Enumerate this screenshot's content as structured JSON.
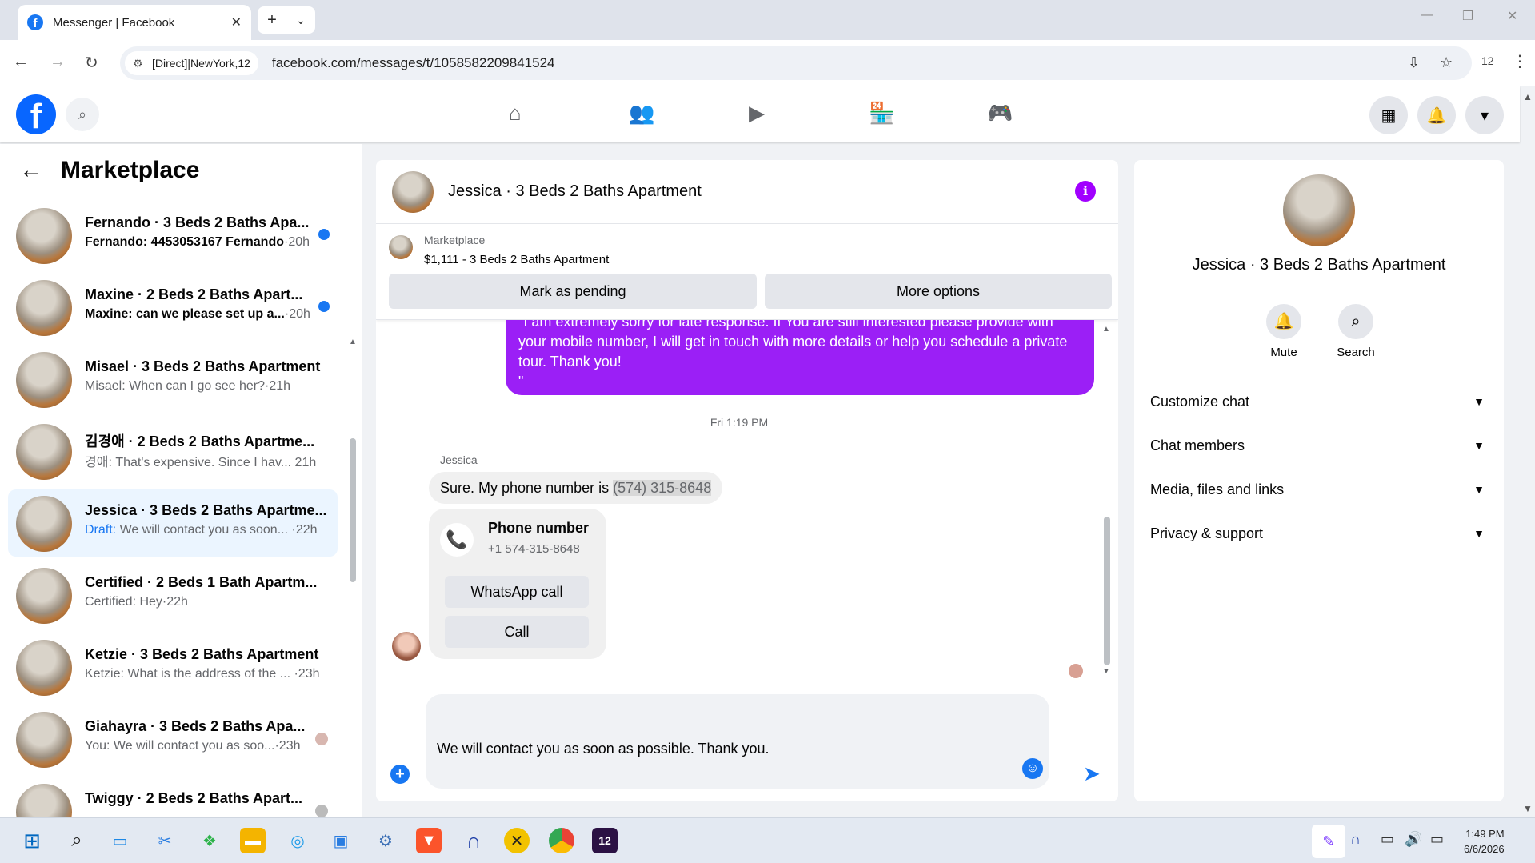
{
  "browser": {
    "tab_title": "Messenger | Facebook",
    "url": "facebook.com/messages/t/1058582209841524",
    "site_chip": "[Direct]|NewYork,12",
    "profile_count": "12"
  },
  "left": {
    "title": "Marketplace",
    "conversations": [
      {
        "name": "Fernando · 3 Beds 2 Baths Apa...",
        "preview": "Fernando: 4453053167 Fernando",
        "time": "·20h",
        "unread": true
      },
      {
        "name": "Maxine · 2 Beds 2 Baths Apart...",
        "preview": "Maxine: can we please set up a...",
        "time": "·20h",
        "unread": true
      },
      {
        "name": "Misael · 3 Beds 2 Baths Apartment",
        "preview": "Misael: When can I go see her?",
        "time": "·21h"
      },
      {
        "name": "김경애 · 2 Beds 2 Baths Apartme...",
        "preview": "경애: That's expensive. Since I hav...",
        "time": "21h"
      },
      {
        "name": "Jessica · 3 Beds 2 Baths Apartme...",
        "draft_label": "Draft:",
        "preview": " We will contact you as soon...",
        "time": "·22h"
      },
      {
        "name": "Certified · 2 Beds 1 Bath Apartm...",
        "preview": "Certified: Hey",
        "time": "·22h"
      },
      {
        "name": "Ketzie · 3 Beds 2 Baths Apartment",
        "preview": "Ketzie: What is the address of the ...",
        "time": "·23h"
      },
      {
        "name": "Giahayra · 3 Beds 2 Baths Apa...",
        "preview": "You: We will contact you as soo...",
        "time": "·23h"
      },
      {
        "name": "Twiggy · 2 Beds 2 Baths Apart...",
        "preview": "",
        "time": ""
      }
    ]
  },
  "chat": {
    "title": "Jessica · 3 Beds 2 Baths Apartment",
    "marketplace_label": "Marketplace",
    "listing": "$1,111 - 3 Beds 2 Baths Apartment",
    "mark_pending": "Mark as pending",
    "more_options": "More options",
    "outgoing_cut": "\"I am extremely sorry for late response. If You are still interested please provide with",
    "outgoing_text": "your mobile number, I will get in touch with more details or help you schedule a private tour. Thank you!",
    "outgoing_quote": "\"",
    "timestamp": "Fri 1:19 PM",
    "sender": "Jessica",
    "incoming_text": "Sure. My phone number is ",
    "incoming_phone": "(574) 315-8648",
    "card_title": "Phone number",
    "card_number": "+1 574-315-8648",
    "whatsapp": "WhatsApp call",
    "call": "Call",
    "composer_text": "We will contact you as soon as possible. Thank you."
  },
  "right": {
    "name": "Jessica · 3 Beds 2 Baths Apartment",
    "mute": "Mute",
    "search": "Search",
    "rows": [
      "Customize chat",
      "Chat members",
      "Media, files and links",
      "Privacy & support"
    ]
  },
  "taskbar": {
    "time": "1:49 PM",
    "date": "6/6/2026",
    "badge": "12"
  },
  "colors": {
    "accent": "#1877f2",
    "outgoing_bubble": "#9b1ff6",
    "info_icon": "#a100ff"
  }
}
